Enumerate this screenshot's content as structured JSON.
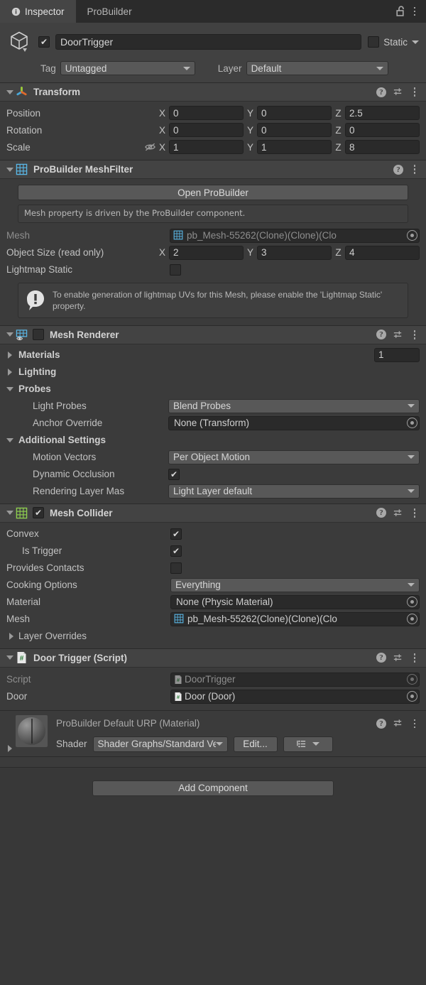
{
  "window": {
    "tabs": [
      {
        "label": "Inspector",
        "icon": "info-icon",
        "active": true
      },
      {
        "label": "ProBuilder",
        "icon": "",
        "active": false
      }
    ],
    "lock_icon": "unlocked-padlock-icon",
    "menu_icon": "kebab-menu-icon"
  },
  "object_header": {
    "icon": "game-object-cube-icon",
    "enabled": true,
    "name": "DoorTrigger",
    "static_checked": false,
    "static_label": "Static",
    "tag_label": "Tag",
    "tag_value": "Untagged",
    "layer_label": "Layer",
    "layer_value": "Default"
  },
  "components": [
    {
      "id": "transform",
      "title": "Transform",
      "icon": "transform-gizmo-icon",
      "expanded": true,
      "rows": [
        {
          "label": "Position",
          "x": "0",
          "y": "0",
          "z": "2.5"
        },
        {
          "label": "Rotation",
          "x": "0",
          "y": "0",
          "z": "0"
        },
        {
          "label": "Scale",
          "x": "1",
          "y": "1",
          "z": "8",
          "lock_icon": "constrained-proportions-off-icon"
        }
      ],
      "axis_labels": {
        "x": "X",
        "y": "Y",
        "z": "Z"
      }
    },
    {
      "id": "probuilder-meshfilter",
      "title": "ProBuilder MeshFilter",
      "icon": "probuilder-grid-icon",
      "expanded": true,
      "open_button": "Open ProBuilder",
      "driven_note": "Mesh property is driven by the ProBuilder component.",
      "mesh_label": "Mesh",
      "mesh_value": "pb_Mesh-55262(Clone)(Clone)(Clo",
      "object_size_label": "Object Size (read only)",
      "object_size": {
        "x": "2",
        "y": "3",
        "z": "4"
      },
      "lightmap_static_label": "Lightmap Static",
      "lightmap_static_checked": false,
      "warning": "To enable generation of lightmap UVs for this Mesh, please enable the 'Lightmap Static' property."
    },
    {
      "id": "mesh-renderer",
      "title": "Mesh Renderer",
      "icon": "mesh-renderer-icon",
      "enabled": false,
      "expanded": true,
      "materials_label": "Materials",
      "materials_count": "1",
      "lighting_label": "Lighting",
      "probes_label": "Probes",
      "light_probes_label": "Light Probes",
      "light_probes_value": "Blend Probes",
      "anchor_override_label": "Anchor Override",
      "anchor_override_value": "None (Transform)",
      "additional_settings_label": "Additional Settings",
      "motion_vectors_label": "Motion Vectors",
      "motion_vectors_value": "Per Object Motion",
      "dynamic_occlusion_label": "Dynamic Occlusion",
      "dynamic_occlusion_checked": true,
      "rendering_layer_label": "Rendering Layer Mas",
      "rendering_layer_value": "Light Layer default"
    },
    {
      "id": "mesh-collider",
      "title": "Mesh Collider",
      "icon": "mesh-collider-icon",
      "enabled": true,
      "expanded": true,
      "convex_label": "Convex",
      "convex_checked": true,
      "is_trigger_label": "Is Trigger",
      "is_trigger_checked": true,
      "provides_contacts_label": "Provides Contacts",
      "provides_contacts_checked": false,
      "cooking_options_label": "Cooking Options",
      "cooking_options_value": "Everything",
      "material_label": "Material",
      "material_value": "None (Physic Material)",
      "mesh_label": "Mesh",
      "mesh_value": "pb_Mesh-55262(Clone)(Clone)(Clo",
      "layer_overrides_label": "Layer Overrides"
    },
    {
      "id": "door-trigger-script",
      "title": "Door Trigger (Script)",
      "icon": "csharp-script-icon",
      "expanded": true,
      "script_label": "Script",
      "script_value": "DoorTrigger",
      "door_label": "Door",
      "door_value": "Door (Door)"
    }
  ],
  "material_preview": {
    "title": "ProBuilder Default URP (Material)",
    "icon": "material-sphere-preview",
    "shader_label": "Shader",
    "shader_value": "Shader Graphs/Standard Verte»",
    "edit_button": "Edit...",
    "list_icon": "shader-list-icon"
  },
  "footer": {
    "add_component": "Add Component"
  },
  "colors": {
    "panel_bg": "#3b3b3b",
    "header_bg": "#434343",
    "tabbar_bg": "#2b2b2b",
    "field_bg": "#2a2a2a",
    "dropdown_bg": "#585858",
    "text": "#c4c4c4",
    "probuilder_blue": "#5ab8e8",
    "collider_green": "#8fd14f"
  }
}
